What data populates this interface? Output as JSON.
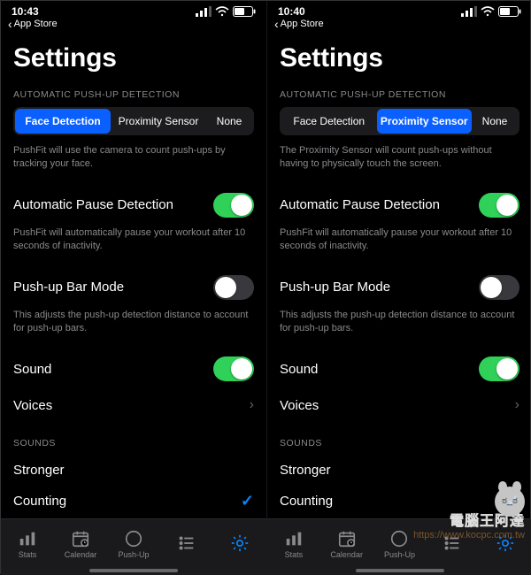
{
  "screens": [
    {
      "time": "10:43",
      "back_label": "App Store",
      "title": "Settings",
      "detection": {
        "section_label": "AUTOMATIC PUSH-UP DETECTION",
        "options": [
          "Face Detection",
          "Proximity Sensor",
          "None"
        ],
        "selected_index": 0,
        "description": "PushFit will use the camera to count push-ups by tracking your face."
      },
      "pause": {
        "label": "Automatic Pause Detection",
        "on": true,
        "description": "PushFit will automatically pause your workout after 10 seconds of inactivity."
      },
      "bar_mode": {
        "label": "Push-up Bar Mode",
        "on": false,
        "description": "This adjusts the push-up detection distance to account for push-up bars."
      },
      "sound": {
        "label": "Sound",
        "on": true
      },
      "voices": {
        "label": "Voices"
      },
      "sounds_section": {
        "label": "SOUNDS",
        "items": [
          {
            "label": "Stronger",
            "selected": false
          },
          {
            "label": "Counting",
            "selected": true
          }
        ]
      },
      "tabs": [
        "Stats",
        "Calendar",
        "Push-Up",
        "",
        ""
      ],
      "active_tab": 4
    },
    {
      "time": "10:40",
      "back_label": "App Store",
      "title": "Settings",
      "detection": {
        "section_label": "AUTOMATIC PUSH-UP DETECTION",
        "options": [
          "Face Detection",
          "Proximity Sensor",
          "None"
        ],
        "selected_index": 1,
        "description": "The Proximity Sensor will count push-ups without having to physically touch the screen."
      },
      "pause": {
        "label": "Automatic Pause Detection",
        "on": true,
        "description": "PushFit will automatically pause your workout after 10 seconds of inactivity."
      },
      "bar_mode": {
        "label": "Push-up Bar Mode",
        "on": false,
        "description": "This adjusts the push-up detection distance to account for push-up bars."
      },
      "sound": {
        "label": "Sound",
        "on": true
      },
      "voices": {
        "label": "Voices"
      },
      "sounds_section": {
        "label": "SOUNDS",
        "items": [
          {
            "label": "Stronger",
            "selected": false
          },
          {
            "label": "Counting",
            "selected": true
          }
        ]
      },
      "tabs": [
        "Stats",
        "Calendar",
        "Push-Up",
        "",
        ""
      ],
      "active_tab": 4
    }
  ],
  "watermark": {
    "line1": "電腦王阿達",
    "line2": "https://www.kocpc.com.tw"
  }
}
